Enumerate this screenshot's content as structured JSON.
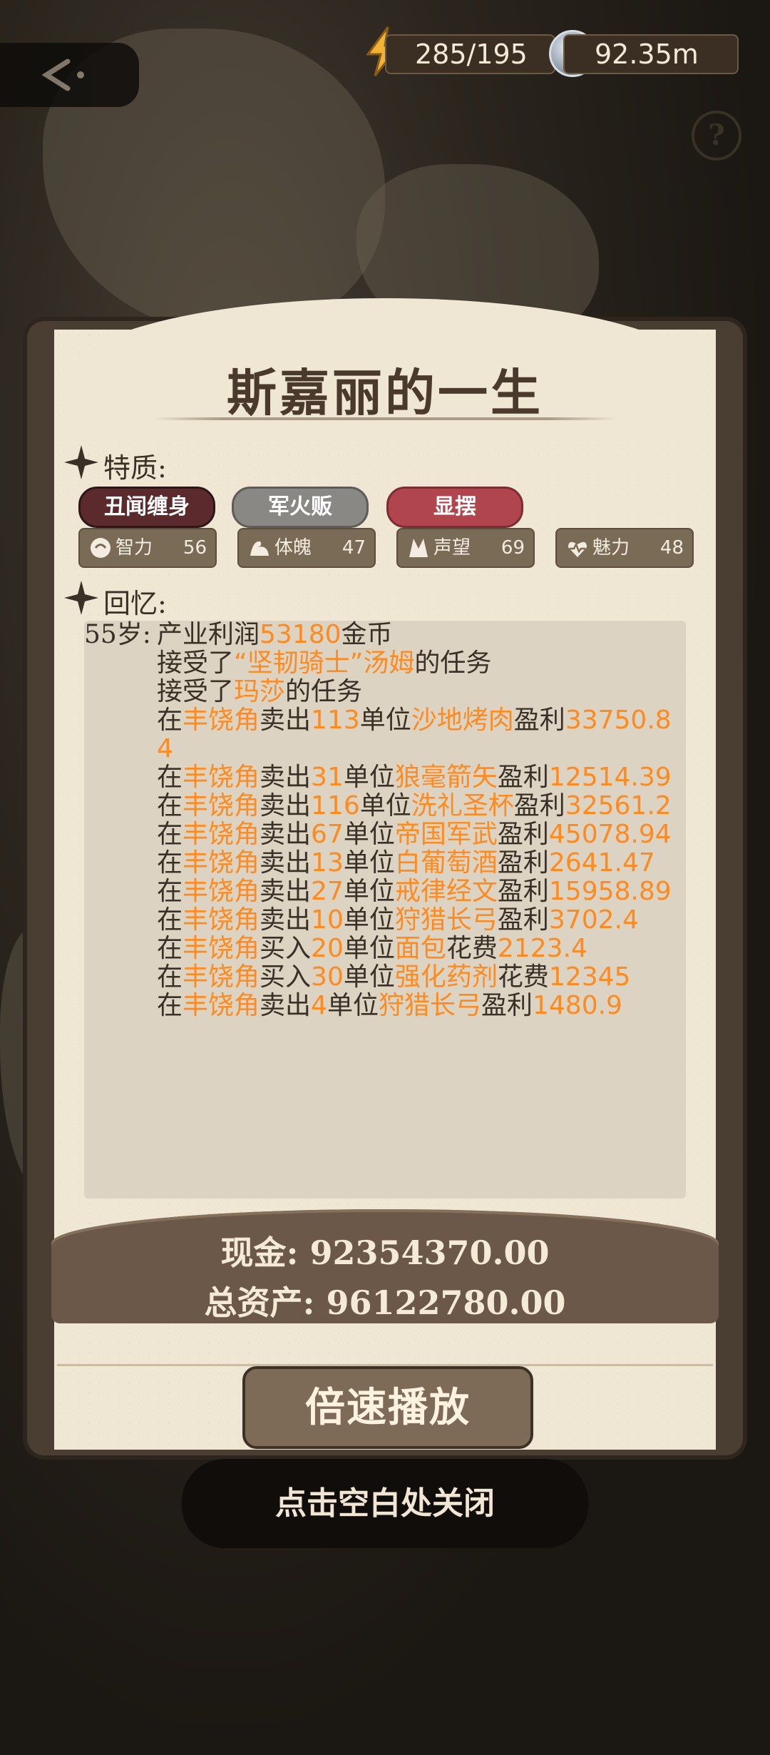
{
  "status": {
    "energy": "285/195",
    "coins": "92.35m"
  },
  "panel": {
    "title": "斯嘉丽的一生",
    "traits_label": "特质:",
    "traits": [
      "丑闻缠身",
      "军火贩",
      "显摆"
    ],
    "stats": [
      {
        "icon": "brain-icon",
        "name": "智力",
        "value": "56"
      },
      {
        "icon": "muscle-icon",
        "name": "体魄",
        "value": "47"
      },
      {
        "icon": "fame-icon",
        "name": "声望",
        "value": "69"
      },
      {
        "icon": "heartbeat-icon",
        "name": "魅力",
        "value": "48"
      }
    ],
    "memory_label": "回忆:",
    "memory": {
      "age": "55岁:",
      "lines": [
        [
          {
            "t": "产业利润"
          },
          {
            "t": "53180",
            "h": true
          },
          {
            "t": "金币"
          }
        ],
        [
          {
            "t": "接受了"
          },
          {
            "t": "“坚韧骑士”汤姆",
            "h": true
          },
          {
            "t": "的任务"
          }
        ],
        [
          {
            "t": "接受了"
          },
          {
            "t": "玛莎",
            "h": true
          },
          {
            "t": "的任务"
          }
        ],
        [
          {
            "t": "在"
          },
          {
            "t": "丰饶角",
            "h": true
          },
          {
            "t": "卖出"
          },
          {
            "t": "113",
            "h": true
          },
          {
            "t": "单位"
          },
          {
            "t": "沙地烤肉",
            "h": true
          },
          {
            "t": "盈利"
          },
          {
            "t": "33750.84",
            "h": true
          }
        ],
        [
          {
            "t": "在"
          },
          {
            "t": "丰饶角",
            "h": true
          },
          {
            "t": "卖出"
          },
          {
            "t": "31",
            "h": true
          },
          {
            "t": "单位"
          },
          {
            "t": "狼毫箭矢",
            "h": true
          },
          {
            "t": "盈利"
          },
          {
            "t": "12514.39",
            "h": true
          }
        ],
        [
          {
            "t": "在"
          },
          {
            "t": "丰饶角",
            "h": true
          },
          {
            "t": "卖出"
          },
          {
            "t": "116",
            "h": true
          },
          {
            "t": "单位"
          },
          {
            "t": "洗礼圣杯",
            "h": true
          },
          {
            "t": "盈利"
          },
          {
            "t": "32561.2",
            "h": true
          }
        ],
        [
          {
            "t": "在"
          },
          {
            "t": "丰饶角",
            "h": true
          },
          {
            "t": "卖出"
          },
          {
            "t": "67",
            "h": true
          },
          {
            "t": "单位"
          },
          {
            "t": "帝国军武",
            "h": true
          },
          {
            "t": "盈利"
          },
          {
            "t": "45078.94",
            "h": true
          }
        ],
        [
          {
            "t": "在"
          },
          {
            "t": "丰饶角",
            "h": true
          },
          {
            "t": "卖出"
          },
          {
            "t": "13",
            "h": true
          },
          {
            "t": "单位"
          },
          {
            "t": "白葡萄酒",
            "h": true
          },
          {
            "t": "盈利"
          },
          {
            "t": "2641.47",
            "h": true
          }
        ],
        [
          {
            "t": "在"
          },
          {
            "t": "丰饶角",
            "h": true
          },
          {
            "t": "卖出"
          },
          {
            "t": "27",
            "h": true
          },
          {
            "t": "单位"
          },
          {
            "t": "戒律经文",
            "h": true
          },
          {
            "t": "盈利"
          },
          {
            "t": "15958.89",
            "h": true
          }
        ],
        [
          {
            "t": "在"
          },
          {
            "t": "丰饶角",
            "h": true
          },
          {
            "t": "卖出"
          },
          {
            "t": "10",
            "h": true
          },
          {
            "t": "单位"
          },
          {
            "t": "狩猎长弓",
            "h": true
          },
          {
            "t": "盈利"
          },
          {
            "t": "3702.4",
            "h": true
          }
        ],
        [
          {
            "t": "在"
          },
          {
            "t": "丰饶角",
            "h": true
          },
          {
            "t": "买入"
          },
          {
            "t": "20",
            "h": true
          },
          {
            "t": "单位"
          },
          {
            "t": "面包",
            "h": true
          },
          {
            "t": "花费"
          },
          {
            "t": "2123.4",
            "h": true
          }
        ],
        [
          {
            "t": "在"
          },
          {
            "t": "丰饶角",
            "h": true
          },
          {
            "t": "买入"
          },
          {
            "t": "30",
            "h": true
          },
          {
            "t": "单位"
          },
          {
            "t": "强化药剂",
            "h": true
          },
          {
            "t": "花费"
          },
          {
            "t": "12345",
            "h": true
          }
        ],
        [
          {
            "t": "在"
          },
          {
            "t": "丰饶角",
            "h": true
          },
          {
            "t": "卖出"
          },
          {
            "t": "4",
            "h": true
          },
          {
            "t": "单位"
          },
          {
            "t": "狩猎长弓",
            "h": true
          },
          {
            "t": "盈利"
          },
          {
            "t": "1480.9",
            "h": true
          }
        ]
      ]
    },
    "cash_line": "现金: 92354370.00",
    "assets_line": "总资产: 96122780.00",
    "speed_button": "倍速播放"
  },
  "close_hint": "点击空白处关闭",
  "colors": {
    "highlight": "#ff8a1f",
    "parchment": "#efe6d4",
    "panel_frame": "#4a3e32"
  }
}
